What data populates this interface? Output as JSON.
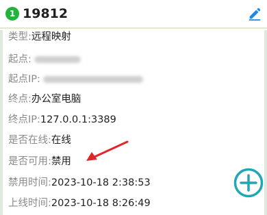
{
  "header": {
    "badge": "1",
    "title": "19812"
  },
  "fields": [
    {
      "label": "类型:",
      "value": "远程映射"
    },
    {
      "label": "起点:",
      "value": "",
      "obscured": true
    },
    {
      "label": "起点IP:",
      "value": "",
      "obscured": true
    },
    {
      "label": "终点:",
      "value": "办公室电脑"
    },
    {
      "label": "终点IP:",
      "value": "127.0.0.1:3389"
    },
    {
      "label": "是否在线:",
      "value": "在线"
    },
    {
      "label": "是否可用:",
      "value": "禁用"
    },
    {
      "label": "禁用时间:",
      "value": "2023-10-18 2:38:53"
    },
    {
      "label": "上线时间:",
      "value": "2023-10-18 8:26:49"
    }
  ],
  "icons": {
    "edit": "edit-icon",
    "add": "add-circle-icon",
    "annotation": "red-arrow-icon"
  },
  "colors": {
    "badge": "#22b33a",
    "edit_icon": "#1e88e5",
    "add_button": "#1fa7b3",
    "annotation_arrow": "#e0262b",
    "header_border": "#dfe9cf"
  }
}
